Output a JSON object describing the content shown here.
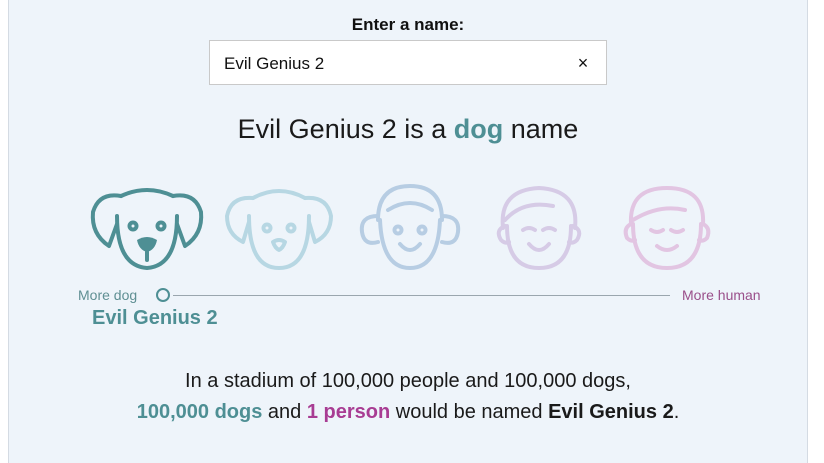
{
  "prompt_label": "Enter a name:",
  "input": {
    "value": "Evil Genius 2",
    "clear_icon": "×"
  },
  "headline": {
    "name": "Evil Genius 2",
    "is_a": " is a ",
    "kind": "dog",
    "suffix": " name"
  },
  "slider": {
    "left_label": "More dog",
    "right_label": "More human",
    "selected_name": "Evil Genius 2",
    "position": 0
  },
  "faces": [
    "dog-face-icon",
    "dog-like-face-icon",
    "neutral-face-icon",
    "human-like-face-icon",
    "human-face-icon"
  ],
  "stat": {
    "line1": "In a stadium of 100,000 people and 100,000 dogs,",
    "dogs": "100,000 dogs",
    "and": " and ",
    "people": "1 person",
    "would": " would be named ",
    "name": "Evil Genius 2",
    "period": "."
  },
  "colors": {
    "dog": "#4e8f94",
    "human": "#a83c93",
    "background": "#eef4fa"
  }
}
